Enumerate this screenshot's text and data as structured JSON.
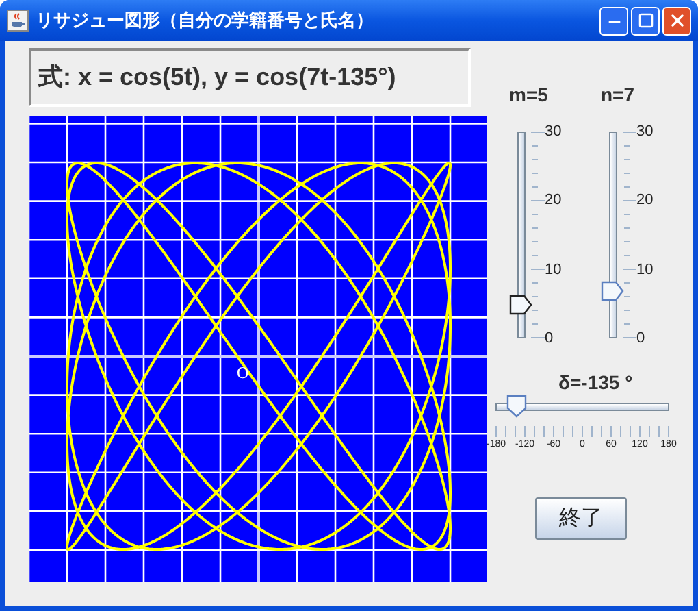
{
  "window": {
    "title": "リサジュー図形（自分の学籍番号と氏名）"
  },
  "formula": "式: x = cos(5t),  y = cos(7t-135°)",
  "plot": {
    "origin_label": "O"
  },
  "sliders": [
    {
      "label": "m=5",
      "level": 0.1667,
      "ticks": [
        "30",
        "20",
        "10",
        "0"
      ]
    },
    {
      "label": "n=7",
      "level": 0.2333,
      "ticks": [
        "30",
        "20",
        "10",
        "0"
      ]
    }
  ],
  "delta": {
    "label": "δ=-135 °",
    "level": 0.125,
    "ticks": [
      "-180",
      "-120",
      "-60",
      "0",
      "60",
      "120",
      "180"
    ]
  },
  "button": "終了"
}
